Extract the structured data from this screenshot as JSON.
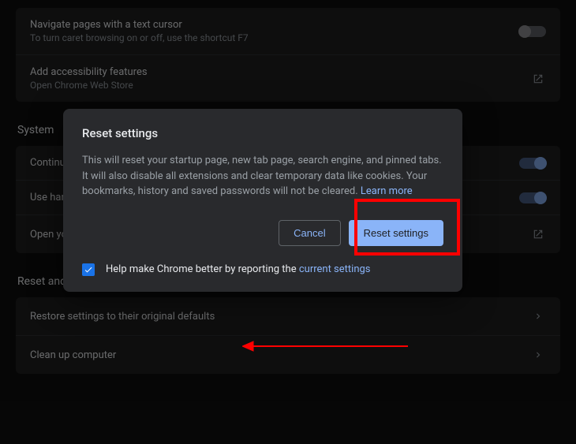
{
  "rows": {
    "caret": {
      "title": "Navigate pages with a text cursor",
      "sub": "To turn caret browsing on or off, use the shortcut F7"
    },
    "accessibility": {
      "title": "Add accessibility features",
      "sub": "Open Chrome Web Store"
    },
    "continue": {
      "title": "Continue running background apps when Google Chrome is closed"
    },
    "hwaccel": {
      "title": "Use hardware acceleration when available"
    },
    "proxy": {
      "title": "Open your computer's proxy settings"
    },
    "restore": {
      "title": "Restore settings to their original defaults"
    },
    "cleanup": {
      "title": "Clean up computer"
    }
  },
  "sections": {
    "system": "System",
    "reset": "Reset and clean up"
  },
  "dialog": {
    "title": "Reset settings",
    "body_prefix": "This will reset your startup page, new tab page, search engine, and pinned tabs. It will also disable all extensions and clear temporary data like cookies. Your bookmarks, history and saved passwords will not be cleared. ",
    "learn_more": "Learn more",
    "cancel": "Cancel",
    "confirm": "Reset settings",
    "checkbox_prefix": "Help make Chrome better by reporting the ",
    "checkbox_link": "current settings"
  }
}
